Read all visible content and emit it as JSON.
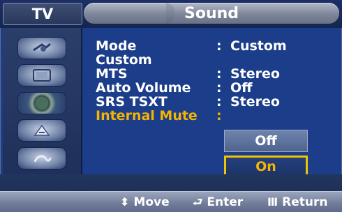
{
  "header": {
    "left_tab": "TV",
    "title": "Sound"
  },
  "sidebar": {
    "items": [
      {
        "icon": "picture-icon"
      },
      {
        "icon": "tv-icon"
      },
      {
        "icon": "speaker-icon"
      },
      {
        "icon": "channel-icon"
      },
      {
        "icon": "setup-icon"
      }
    ]
  },
  "menu": {
    "items": [
      {
        "label": "Mode",
        "colon": ":",
        "value": "Custom"
      },
      {
        "label": "Custom",
        "colon": "",
        "value": ""
      },
      {
        "label": "MTS",
        "colon": ":",
        "value": "Stereo"
      },
      {
        "label": "Auto Volume",
        "colon": ":",
        "value": "Off"
      },
      {
        "label": "SRS TSXT",
        "colon": ":",
        "value": "Stereo"
      },
      {
        "label": "Internal Mute",
        "colon": ":",
        "value": ""
      }
    ],
    "selected_index": 5
  },
  "dropdown": {
    "options": [
      "Off",
      "On"
    ],
    "selected": "On"
  },
  "footer": {
    "move": "Move",
    "enter": "Enter",
    "return": "Return"
  },
  "colors": {
    "background": "#1c3d8a",
    "highlight": "#f5b400"
  }
}
